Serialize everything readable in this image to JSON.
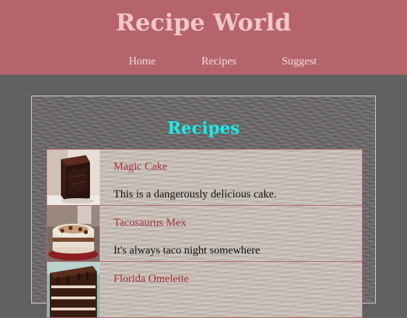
{
  "site": {
    "title": "Recipe World"
  },
  "nav": {
    "items": [
      {
        "label": "Home"
      },
      {
        "label": "Recipes"
      },
      {
        "label": "Suggest"
      }
    ]
  },
  "main": {
    "heading": "Recipes",
    "recipes": [
      {
        "name": "Magic Cake",
        "description": "This is a dangerously delicious cake.",
        "image_icon": "chocolate-cake-slice-image"
      },
      {
        "name": "Tacosaurus Mex",
        "description": "It's always taco night somewhere",
        "image_icon": "cream-cake-image"
      },
      {
        "name": "Florida Omelette",
        "description": "",
        "image_icon": "layered-cake-image"
      }
    ]
  },
  "colors": {
    "header_bg": "#b4646a",
    "title_color": "#f2c6c6",
    "heading_color": "#18ecea",
    "link_color": "#a2323a",
    "page_bg": "#616161"
  }
}
